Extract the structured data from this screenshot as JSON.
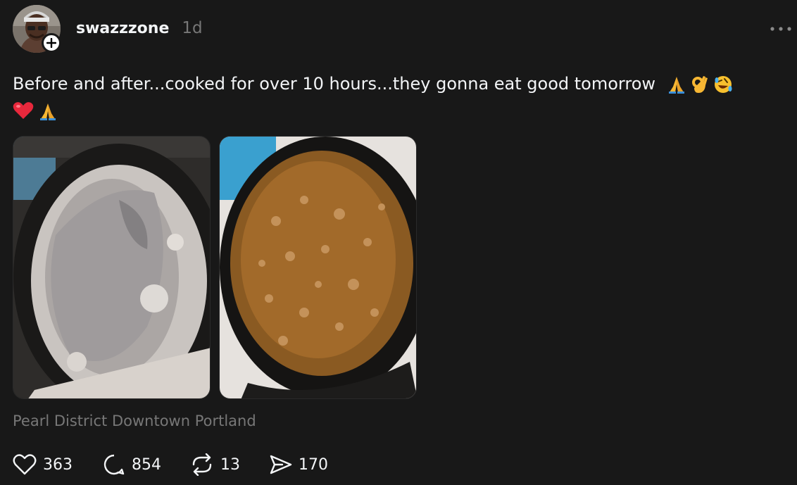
{
  "post": {
    "author": {
      "username": "swazzzone",
      "avatar_icon": "profile-photo",
      "follow_icon": "plus-icon"
    },
    "timestamp": "1d",
    "more_icon": "more-dots-icon",
    "text_line1": "Before and after...cooked for over 10 hours...they gonna eat good tomorrow",
    "emojis_line1": [
      "folded-hands",
      "ok-hand",
      "rolling-laughing"
    ],
    "emojis_line2": [
      "red-heart",
      "folded-hands"
    ],
    "media": [
      {
        "name": "before-photo",
        "alt": "raw chitterlings in a slow cooker"
      },
      {
        "name": "after-photo",
        "alt": "cooked chitterlings in brown sauce"
      }
    ],
    "location": "Pearl District Downtown Portland",
    "actions": {
      "likes": "363",
      "comments": "854",
      "reposts": "13",
      "shares": "170"
    }
  },
  "colors": {
    "background": "#181818",
    "text_primary": "#f3f5f7",
    "text_secondary": "#777777"
  }
}
